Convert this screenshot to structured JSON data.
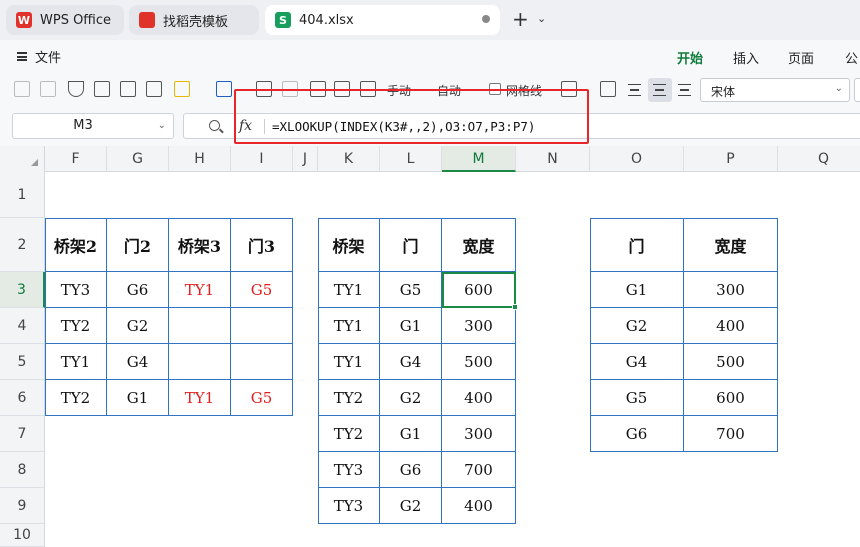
{
  "tabs": {
    "wps": "WPS Office",
    "template": "找稻壳模板",
    "file": "404.xlsx",
    "new_tab": "+",
    "file_icon_letter": "S"
  },
  "menu": {
    "file": "文件",
    "ribbon_tabs": [
      "开始",
      "插入",
      "页面",
      "公"
    ]
  },
  "toolbar": {
    "manual": "手动",
    "auto": "自动",
    "gridlines": "网格线",
    "font": "宋体"
  },
  "formula_bar": {
    "name_box": "M3",
    "fx": "fx",
    "formula": "=XLOOKUP(INDEX(K3#,,2),O3:O7,P3:P7)"
  },
  "columns": [
    "F",
    "G",
    "H",
    "I",
    "J",
    "K",
    "L",
    "M",
    "N",
    "O",
    "P",
    "Q"
  ],
  "rows": [
    "1",
    "2",
    "3",
    "4",
    "5",
    "6",
    "7",
    "8",
    "9",
    "10"
  ],
  "selected": {
    "column": "M",
    "row": "3"
  },
  "colors": {
    "accent": "#1b8a44",
    "table_border": "#2f73c2",
    "red_text": "#e02020",
    "highlight_box": "#e8252b"
  },
  "table1": {
    "headers": [
      "桥架2",
      "门2",
      "桥架3",
      "门3"
    ],
    "rows": [
      [
        "TY3",
        "G6",
        "TY1",
        "G5"
      ],
      [
        "TY2",
        "G2",
        "",
        ""
      ],
      [
        "TY1",
        "G4",
        "",
        ""
      ],
      [
        "TY2",
        "G1",
        "TY1",
        "G5"
      ]
    ]
  },
  "table2": {
    "headers": [
      "桥架",
      "门",
      "宽度"
    ],
    "rows": [
      [
        "TY1",
        "G5",
        "600"
      ],
      [
        "TY1",
        "G1",
        "300"
      ],
      [
        "TY1",
        "G4",
        "500"
      ],
      [
        "TY2",
        "G2",
        "400"
      ],
      [
        "TY2",
        "G1",
        "300"
      ],
      [
        "TY3",
        "G6",
        "700"
      ],
      [
        "TY3",
        "G2",
        "400"
      ]
    ]
  },
  "table3": {
    "headers": [
      "门",
      "宽度"
    ],
    "rows": [
      [
        "G1",
        "300"
      ],
      [
        "G2",
        "400"
      ],
      [
        "G4",
        "500"
      ],
      [
        "G5",
        "600"
      ],
      [
        "G6",
        "700"
      ]
    ]
  }
}
